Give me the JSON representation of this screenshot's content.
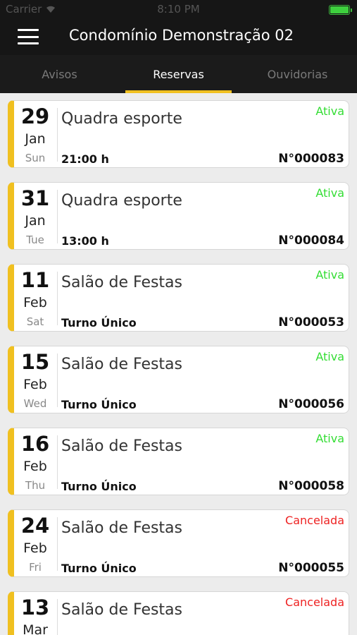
{
  "status_bar": {
    "carrier": "Carrier",
    "time": "8:10 PM"
  },
  "header": {
    "title": "Condomínio Demonstração 02"
  },
  "tabs": [
    {
      "label": "Avisos",
      "active": false
    },
    {
      "label": "Reservas",
      "active": true
    },
    {
      "label": "Ouvidorias",
      "active": false
    }
  ],
  "colors": {
    "accent": "#f0c020",
    "active_status": "#33dd33",
    "cancelled_status": "#ee2222"
  },
  "reservations": [
    {
      "day": "29",
      "month": "Jan",
      "weekday": "Sun",
      "title": "Quadra esporte",
      "time": "21:00 h",
      "number": "N°000083",
      "status": "Ativa",
      "status_color": "#33dd33"
    },
    {
      "day": "31",
      "month": "Jan",
      "weekday": "Tue",
      "title": "Quadra esporte",
      "time": "13:00 h",
      "number": "N°000084",
      "status": "Ativa",
      "status_color": "#33dd33"
    },
    {
      "day": "11",
      "month": "Feb",
      "weekday": "Sat",
      "title": "Salão de Festas",
      "time": "Turno Único",
      "number": "N°000053",
      "status": "Ativa",
      "status_color": "#33dd33"
    },
    {
      "day": "15",
      "month": "Feb",
      "weekday": "Wed",
      "title": "Salão de Festas",
      "time": "Turno Único",
      "number": "N°000056",
      "status": "Ativa",
      "status_color": "#33dd33"
    },
    {
      "day": "16",
      "month": "Feb",
      "weekday": "Thu",
      "title": "Salão de Festas",
      "time": "Turno Único",
      "number": "N°000058",
      "status": "Ativa",
      "status_color": "#33dd33"
    },
    {
      "day": "24",
      "month": "Feb",
      "weekday": "Fri",
      "title": "Salão de Festas",
      "time": "Turno Único",
      "number": "N°000055",
      "status": "Cancelada",
      "status_color": "#ee2222"
    },
    {
      "day": "13",
      "month": "Mar",
      "weekday": "",
      "title": "Salão de Festas",
      "time": "",
      "number": "",
      "status": "Cancelada",
      "status_color": "#ee2222"
    }
  ]
}
